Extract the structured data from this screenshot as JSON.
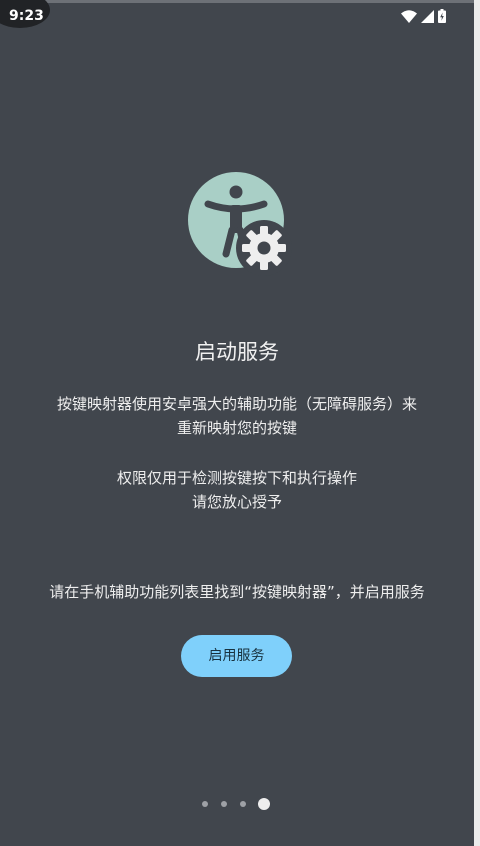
{
  "status_bar": {
    "time": "9:23",
    "icons": [
      "wifi-icon",
      "cellular-icon",
      "battery-icon"
    ]
  },
  "hero_icon": {
    "name": "accessibility-settings-icon",
    "colors": {
      "circle": "#a9cfc6",
      "figure": "#41464d",
      "gear": "#eeeeee"
    }
  },
  "main": {
    "title": "启动服务",
    "description_line1": "按键映射器使用安卓强大的辅助功能（无障碍服务）来",
    "description_line2": "重新映射您的按键",
    "permission_line1": "权限仅用于检测按键按下和执行操作",
    "permission_line2": "请您放心授予",
    "instruction": "请在手机辅助功能列表里找到“按键映射器”，并启用服务",
    "enable_button_label": "启用服务"
  },
  "pager": {
    "page_count": 4,
    "current_page": 4
  },
  "colors": {
    "background": "#41464d",
    "accent_button": "#7fd0fb"
  }
}
